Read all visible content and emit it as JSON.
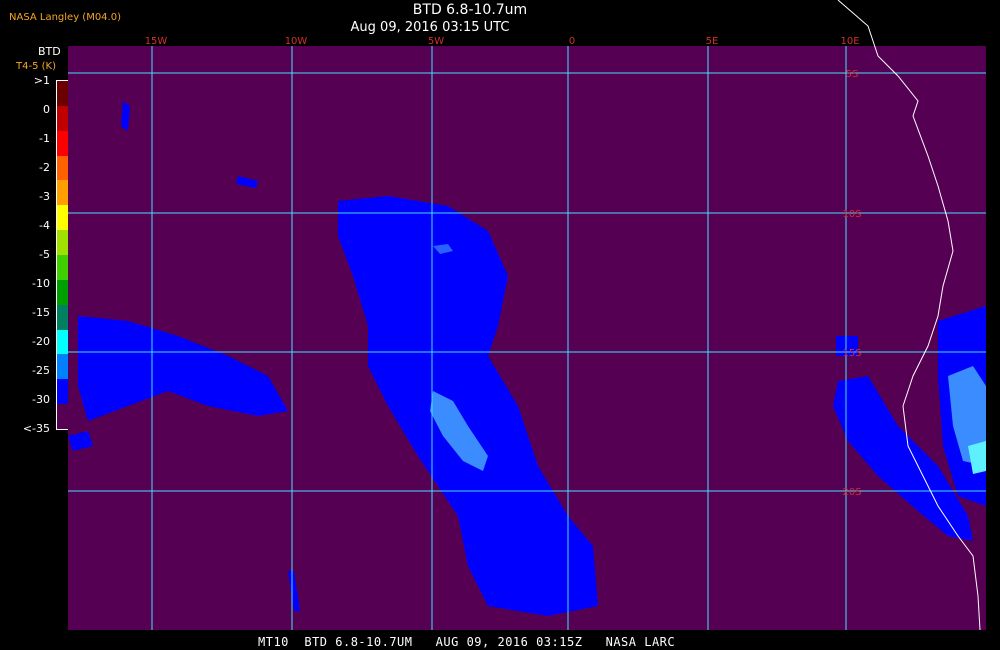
{
  "header": {
    "credit": "NASA Langley (M04.0)",
    "title": "BTD 6.8-10.7um",
    "timestamp": "Aug 09, 2016 03:15 UTC"
  },
  "footer": {
    "caption": "MT10  BTD 6.8-10.7UM   AUG 09, 2016 03:15Z   NASA LARC"
  },
  "legend": {
    "title": "BTD",
    "subtitle": "T4-5 (K)",
    "labels": [
      ">1",
      "0",
      "-1",
      "-2",
      "-3",
      "-4",
      "-5",
      "-10",
      "-15",
      "-20",
      "-25",
      "-30",
      "<-35"
    ],
    "colors": [
      "#6a0000",
      "#c00000",
      "#ff0000",
      "#ff6000",
      "#ffa000",
      "#ffff00",
      "#a0e000",
      "#40d000",
      "#00a000",
      "#008060",
      "#00ffff",
      "#0080ff",
      "#0000ff",
      "#560054"
    ]
  },
  "map": {
    "background_color": "#560054",
    "grid_color": "#40e0ff",
    "coast_color": "#ffffff",
    "lon_labels": [
      "15W",
      "10W",
      "5W",
      "0",
      "5E",
      "10E"
    ],
    "lat_labels": [
      "5S",
      "10S",
      "15S",
      "20S"
    ]
  }
}
